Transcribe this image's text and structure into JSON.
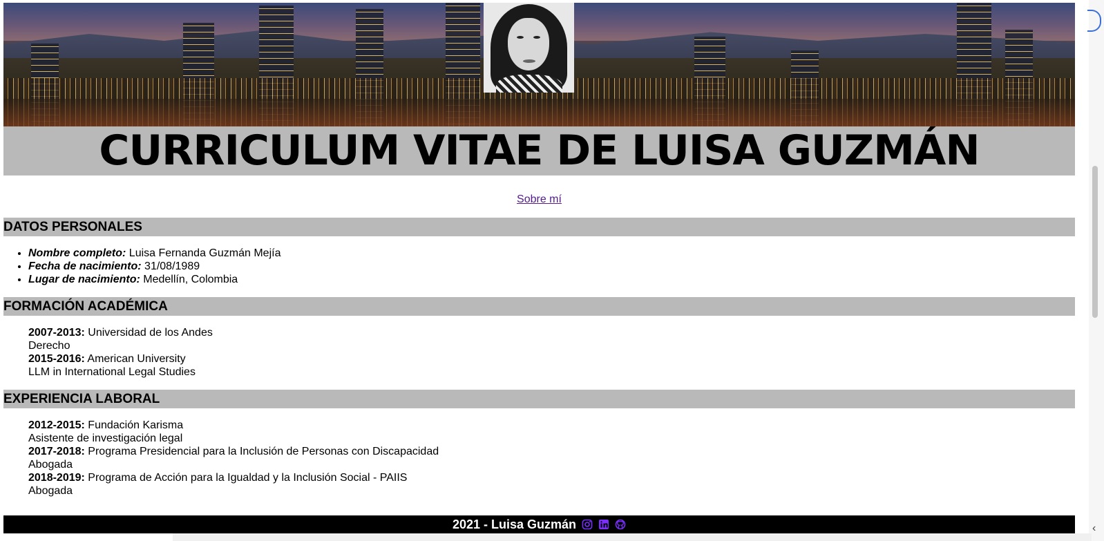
{
  "header": {
    "title": "CURRICULUM VITAE DE LUISA GUZMÁN",
    "about_link": "Sobre mí"
  },
  "sections": {
    "personal": {
      "heading": "DATOS PERSONALES",
      "items": [
        {
          "label": "Nombre completo:",
          "value": " Luisa Fernanda Guzmán Mejía"
        },
        {
          "label": "Fecha de nacimiento:",
          "value": " 31/08/1989"
        },
        {
          "label": "Lugar de nacimiento:",
          "value": " Medellín, Colombia"
        }
      ]
    },
    "education": {
      "heading": "FORMACIÓN ACADÉMICA",
      "entries": [
        {
          "years": "2007-2013:",
          "place": " Universidad de los Andes",
          "detail": "Derecho"
        },
        {
          "years": "2015-2016:",
          "place": " American University",
          "detail": "LLM in International Legal Studies"
        }
      ]
    },
    "experience": {
      "heading": "EXPERIENCIA LABORAL",
      "entries": [
        {
          "years": "2012-2015:",
          "place": " Fundación Karisma",
          "detail": "Asistente de investigación legal"
        },
        {
          "years": "2017-2018:",
          "place": " Programa Presidencial para la Inclusión de Personas con Discapacidad",
          "detail": "Abogada"
        },
        {
          "years": "2018-2019:",
          "place": " Programa de Acción para la Igualdad y la Inclusión Social - PAIIS",
          "detail": "Abogada"
        }
      ]
    }
  },
  "footer": {
    "text": "2021 - Luisa Guzmán",
    "icons": [
      "instagram-icon",
      "linkedin-icon",
      "github-icon"
    ],
    "icon_color": "#7b2fff"
  },
  "colors": {
    "section_bg": "#b9b9b9",
    "link": "#551a8b",
    "footer_bg": "#000000"
  }
}
